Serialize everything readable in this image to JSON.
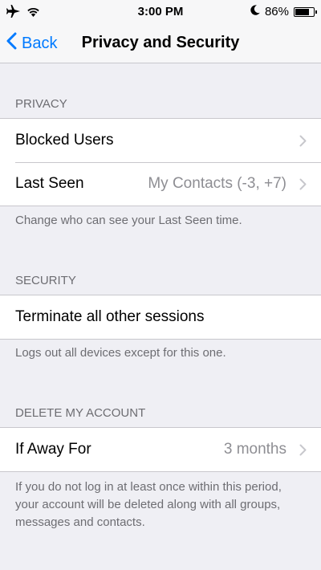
{
  "status_bar": {
    "time": "3:00 PM",
    "battery": "86%",
    "battery_level": 0.86,
    "icons": [
      "airplane-icon",
      "wifi-icon",
      "moon-icon",
      "battery-icon"
    ]
  },
  "nav": {
    "back_label": "Back",
    "title": "Privacy and Security",
    "accent_color": "#007aff"
  },
  "privacy": {
    "header": "PRIVACY",
    "rows": [
      {
        "label": "Blocked Users",
        "value": ""
      },
      {
        "label": "Last Seen",
        "value": "My Contacts (-3, +7)"
      }
    ],
    "footer": "Change who can see your Last Seen time."
  },
  "security": {
    "header": "SECURITY",
    "rows": [
      {
        "label": "Terminate all other sessions"
      }
    ],
    "footer": "Logs out all devices except for this one."
  },
  "delete_account": {
    "header": "DELETE MY ACCOUNT",
    "rows": [
      {
        "label": "If Away For",
        "value": "3 months"
      }
    ],
    "footer": "If you do not log in at least once within this period, your account will be deleted along with all groups, messages and contacts."
  }
}
